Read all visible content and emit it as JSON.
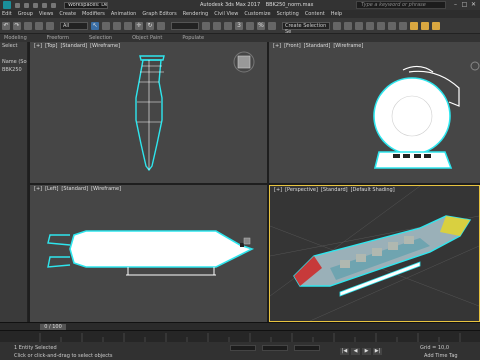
{
  "titlebar": {
    "workspace": "Workspaces: Default",
    "app": "Autodesk 3ds Max 2017",
    "file": "BBK250_norm.max",
    "search_placeholder": "Type a keyword or phrase"
  },
  "menu": [
    "Edit",
    "Group",
    "Views",
    "Create",
    "Modifiers",
    "Animation",
    "Graph Editors",
    "Rendering",
    "Civil View",
    "Customize",
    "Scripting",
    "Content",
    "Help"
  ],
  "toolbar": {
    "view_dropdown": "All",
    "selection_set": "Create Selection Se"
  },
  "ribbon": [
    "Modeling",
    "Freeform",
    "Selection",
    "Object Paint",
    "Populate"
  ],
  "scene_explorer": {
    "rows": [
      "Select",
      "",
      "Name (Sorted Ascer",
      "BBK250"
    ]
  },
  "viewports": {
    "top": [
      "[+]",
      "[Top]",
      "[Standard]",
      "[Wireframe]"
    ],
    "front": [
      "[+]",
      "[Front]",
      "[Standard]",
      "[Wireframe]"
    ],
    "left": [
      "[+]",
      "[Left]",
      "[Standard]",
      "[Wireframe]"
    ],
    "persp": [
      "[+]",
      "[Perspective]",
      "[Standard]",
      "[Default Shading]"
    ]
  },
  "timeline": {
    "frame": "0 / 100"
  },
  "status": {
    "selection": "1 Entity Selected",
    "prompt": "Click or click-and-drag to select objects",
    "grid": "Grid = 10,0",
    "add_time_tag": "Add Time Tag"
  },
  "colors": {
    "wire": "#ffffff",
    "selected": "#00ffff",
    "viewport_bg": "#464646",
    "active_border": "#e8c440"
  }
}
